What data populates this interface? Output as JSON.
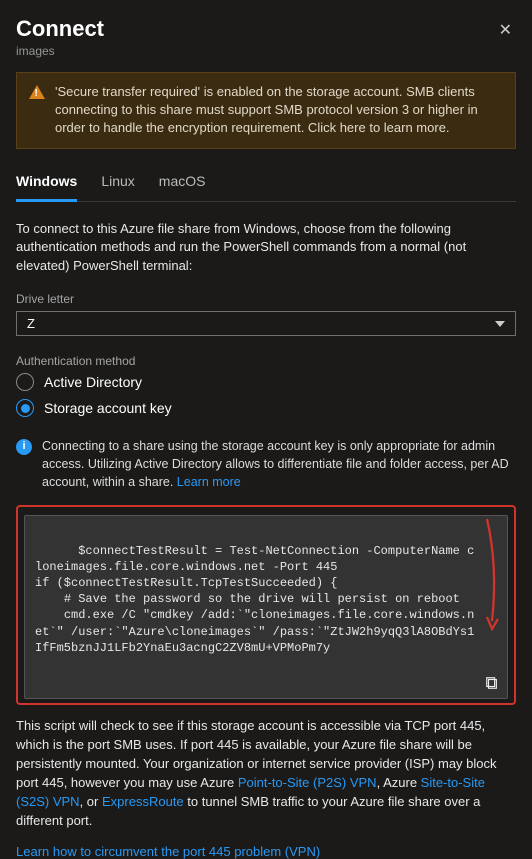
{
  "header": {
    "title": "Connect",
    "subtitle": "images"
  },
  "warning": "'Secure transfer required' is enabled on the storage account. SMB clients connecting to this share must support SMB protocol version 3 or higher in order to handle the encryption requirement. Click here to learn more.",
  "tabs": [
    "Windows",
    "Linux",
    "macOS"
  ],
  "instruction": "To connect to this Azure file share from Windows, choose from the following authentication methods and run the PowerShell commands from a normal (not elevated) PowerShell terminal:",
  "drive": {
    "label": "Drive letter",
    "value": "Z"
  },
  "auth": {
    "label": "Authentication method",
    "opt1": "Active Directory",
    "opt2": "Storage account key"
  },
  "info": {
    "text": "Connecting to a share using the storage account key is only appropriate for admin access. Utilizing Active Directory allows to differentiate file and folder access, per AD account, within a share. ",
    "learn": "Learn more"
  },
  "code": "$connectTestResult = Test-NetConnection -ComputerName cloneimages.file.core.windows.net -Port 445\nif ($connectTestResult.TcpTestSucceeded) {\n    # Save the password so the drive will persist on reboot\n    cmd.exe /C \"cmdkey /add:`\"cloneimages.file.core.windows.net`\" /user:`\"Azure\\cloneimages`\" /pass:`\"ZtJW2h9yqQ3lA8OBdYs1IfFm5bznJJ1LFb2YnaEu3acngC2ZV8mU+VPMoPm7y",
  "explain": {
    "t1": "This script will check to see if this storage account is accessible via TCP port 445, which is the port SMB uses. If port 445 is available, your Azure file share will be persistently mounted. Your organization or internet service provider (ISP) may block port 445, however you may use Azure ",
    "p2s": "Point-to-Site (P2S) VPN",
    "t2": ", Azure ",
    "s2s": "Site-to-Site (S2S) VPN",
    "t3": ", or ",
    "er": "ExpressRoute",
    "t4": " to tunnel SMB traffic to your Azure file share over a different port."
  },
  "learn445": "Learn how to circumvent the port 445 problem (VPN)"
}
